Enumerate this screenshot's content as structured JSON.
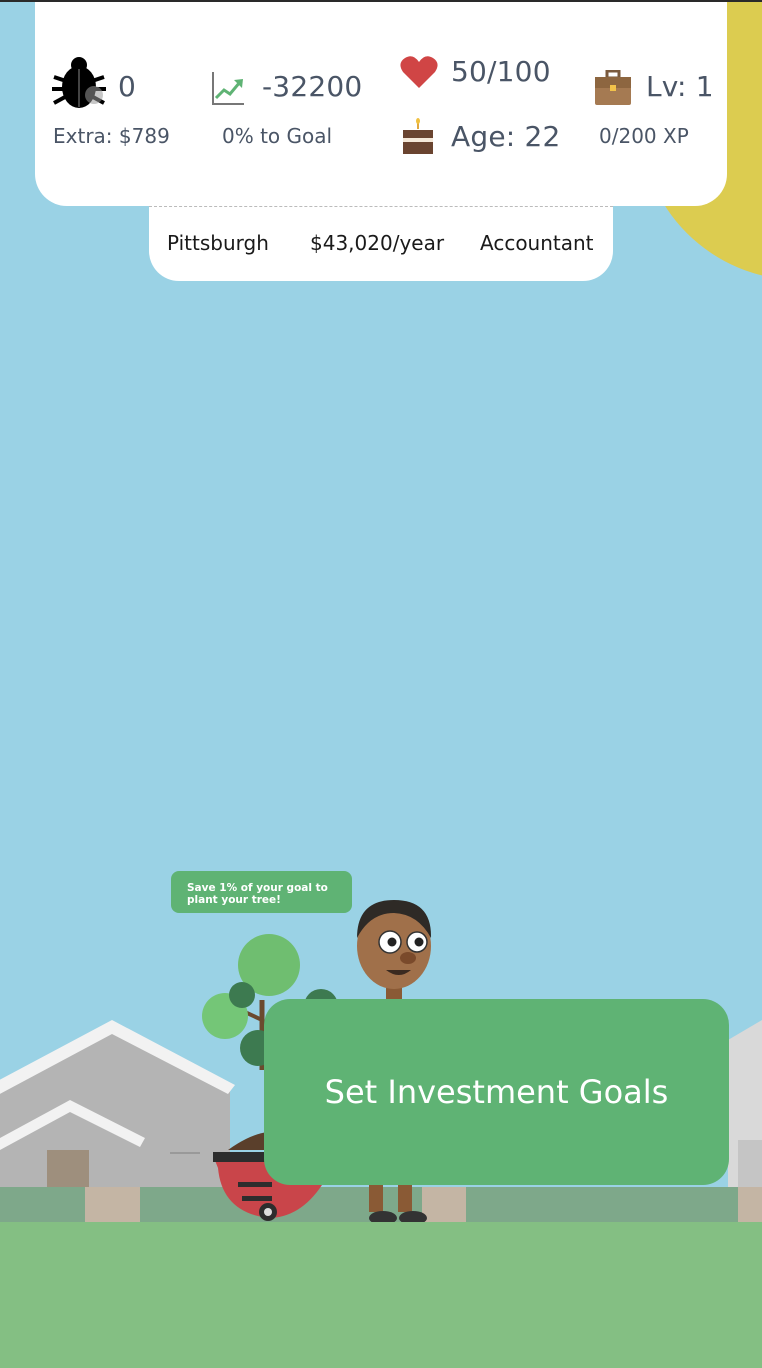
{
  "stats": {
    "bugs": {
      "icon": "bug-icon",
      "value": "0",
      "sub": "Extra: $789"
    },
    "goal": {
      "icon": "chart-up-icon",
      "value": "-32200",
      "sub": "0% to Goal"
    },
    "health": {
      "icon": "heart-icon",
      "value": "50/100"
    },
    "age": {
      "icon": "cake-icon",
      "value": "Age: 22"
    },
    "level": {
      "icon": "briefcase-icon",
      "value": "Lv: 1",
      "sub": "0/200 XP"
    }
  },
  "info": {
    "city": "Pittsburgh",
    "salary": "$43,020/year",
    "job": "Accountant"
  },
  "hint": "Save 1% of your goal to plant your tree!",
  "action_button": "Set Investment Goals",
  "colors": {
    "sky": "#9ad2e5",
    "sun": "#dccc50",
    "accent_green": "#5fb374",
    "grass": "#84bf83",
    "text": "#4a5566",
    "heart": "#d04545"
  }
}
